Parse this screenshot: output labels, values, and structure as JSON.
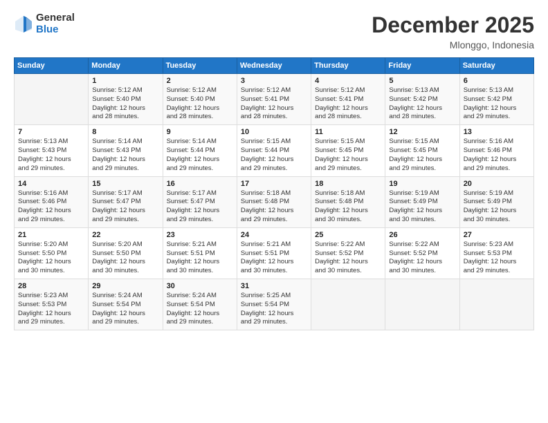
{
  "logo": {
    "general": "General",
    "blue": "Blue"
  },
  "title": "December 2025",
  "location": "Mlonggo, Indonesia",
  "weekdays": [
    "Sunday",
    "Monday",
    "Tuesday",
    "Wednesday",
    "Thursday",
    "Friday",
    "Saturday"
  ],
  "weeks": [
    [
      {
        "day": "",
        "info": ""
      },
      {
        "day": "1",
        "info": "Sunrise: 5:12 AM\nSunset: 5:40 PM\nDaylight: 12 hours\nand 28 minutes."
      },
      {
        "day": "2",
        "info": "Sunrise: 5:12 AM\nSunset: 5:40 PM\nDaylight: 12 hours\nand 28 minutes."
      },
      {
        "day": "3",
        "info": "Sunrise: 5:12 AM\nSunset: 5:41 PM\nDaylight: 12 hours\nand 28 minutes."
      },
      {
        "day": "4",
        "info": "Sunrise: 5:12 AM\nSunset: 5:41 PM\nDaylight: 12 hours\nand 28 minutes."
      },
      {
        "day": "5",
        "info": "Sunrise: 5:13 AM\nSunset: 5:42 PM\nDaylight: 12 hours\nand 28 minutes."
      },
      {
        "day": "6",
        "info": "Sunrise: 5:13 AM\nSunset: 5:42 PM\nDaylight: 12 hours\nand 29 minutes."
      }
    ],
    [
      {
        "day": "7",
        "info": "Sunrise: 5:13 AM\nSunset: 5:43 PM\nDaylight: 12 hours\nand 29 minutes."
      },
      {
        "day": "8",
        "info": "Sunrise: 5:14 AM\nSunset: 5:43 PM\nDaylight: 12 hours\nand 29 minutes."
      },
      {
        "day": "9",
        "info": "Sunrise: 5:14 AM\nSunset: 5:44 PM\nDaylight: 12 hours\nand 29 minutes."
      },
      {
        "day": "10",
        "info": "Sunrise: 5:15 AM\nSunset: 5:44 PM\nDaylight: 12 hours\nand 29 minutes."
      },
      {
        "day": "11",
        "info": "Sunrise: 5:15 AM\nSunset: 5:45 PM\nDaylight: 12 hours\nand 29 minutes."
      },
      {
        "day": "12",
        "info": "Sunrise: 5:15 AM\nSunset: 5:45 PM\nDaylight: 12 hours\nand 29 minutes."
      },
      {
        "day": "13",
        "info": "Sunrise: 5:16 AM\nSunset: 5:46 PM\nDaylight: 12 hours\nand 29 minutes."
      }
    ],
    [
      {
        "day": "14",
        "info": "Sunrise: 5:16 AM\nSunset: 5:46 PM\nDaylight: 12 hours\nand 29 minutes."
      },
      {
        "day": "15",
        "info": "Sunrise: 5:17 AM\nSunset: 5:47 PM\nDaylight: 12 hours\nand 29 minutes."
      },
      {
        "day": "16",
        "info": "Sunrise: 5:17 AM\nSunset: 5:47 PM\nDaylight: 12 hours\nand 29 minutes."
      },
      {
        "day": "17",
        "info": "Sunrise: 5:18 AM\nSunset: 5:48 PM\nDaylight: 12 hours\nand 29 minutes."
      },
      {
        "day": "18",
        "info": "Sunrise: 5:18 AM\nSunset: 5:48 PM\nDaylight: 12 hours\nand 30 minutes."
      },
      {
        "day": "19",
        "info": "Sunrise: 5:19 AM\nSunset: 5:49 PM\nDaylight: 12 hours\nand 30 minutes."
      },
      {
        "day": "20",
        "info": "Sunrise: 5:19 AM\nSunset: 5:49 PM\nDaylight: 12 hours\nand 30 minutes."
      }
    ],
    [
      {
        "day": "21",
        "info": "Sunrise: 5:20 AM\nSunset: 5:50 PM\nDaylight: 12 hours\nand 30 minutes."
      },
      {
        "day": "22",
        "info": "Sunrise: 5:20 AM\nSunset: 5:50 PM\nDaylight: 12 hours\nand 30 minutes."
      },
      {
        "day": "23",
        "info": "Sunrise: 5:21 AM\nSunset: 5:51 PM\nDaylight: 12 hours\nand 30 minutes."
      },
      {
        "day": "24",
        "info": "Sunrise: 5:21 AM\nSunset: 5:51 PM\nDaylight: 12 hours\nand 30 minutes."
      },
      {
        "day": "25",
        "info": "Sunrise: 5:22 AM\nSunset: 5:52 PM\nDaylight: 12 hours\nand 30 minutes."
      },
      {
        "day": "26",
        "info": "Sunrise: 5:22 AM\nSunset: 5:52 PM\nDaylight: 12 hours\nand 30 minutes."
      },
      {
        "day": "27",
        "info": "Sunrise: 5:23 AM\nSunset: 5:53 PM\nDaylight: 12 hours\nand 29 minutes."
      }
    ],
    [
      {
        "day": "28",
        "info": "Sunrise: 5:23 AM\nSunset: 5:53 PM\nDaylight: 12 hours\nand 29 minutes."
      },
      {
        "day": "29",
        "info": "Sunrise: 5:24 AM\nSunset: 5:54 PM\nDaylight: 12 hours\nand 29 minutes."
      },
      {
        "day": "30",
        "info": "Sunrise: 5:24 AM\nSunset: 5:54 PM\nDaylight: 12 hours\nand 29 minutes."
      },
      {
        "day": "31",
        "info": "Sunrise: 5:25 AM\nSunset: 5:54 PM\nDaylight: 12 hours\nand 29 minutes."
      },
      {
        "day": "",
        "info": ""
      },
      {
        "day": "",
        "info": ""
      },
      {
        "day": "",
        "info": ""
      }
    ]
  ]
}
